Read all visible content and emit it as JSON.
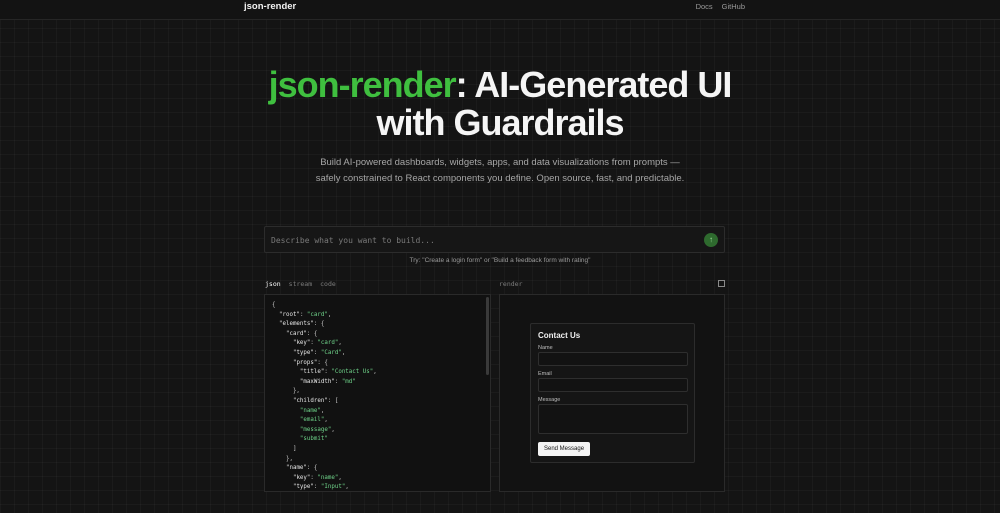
{
  "header": {
    "brand": "json-render",
    "nav": [
      "Docs",
      "GitHub"
    ]
  },
  "hero": {
    "title_accent": "json-render",
    "title_rest_line1": ": AI-Generated UI",
    "title_line2": "with Guardrails",
    "subtitle": "Build AI-powered dashboards, widgets, apps, and data visualizations from prompts — safely constrained to React components you define. Open source, fast, and predictable."
  },
  "prompt": {
    "placeholder": "Describe what you want to build...",
    "value": "",
    "send_icon": "arrow-up-icon",
    "try_text": "Try: \"Create a login form\" or \"Build a feedback form with rating\""
  },
  "tabs": {
    "items": [
      "json",
      "stream",
      "code"
    ],
    "active": "json",
    "render_label": "render"
  },
  "code_lines": [
    "{",
    "  \"root\": \"card\",",
    "  \"elements\": {",
    "    \"card\": {",
    "      \"key\": \"card\",",
    "      \"type\": \"Card\",",
    "      \"props\": {",
    "        \"title\": \"Contact Us\",",
    "        \"maxWidth\": \"md\"",
    "      },",
    "      \"children\": [",
    "        \"name\",",
    "        \"email\",",
    "        \"message\",",
    "        \"submit\"",
    "      ]",
    "    },",
    "    \"name\": {",
    "      \"key\": \"name\",",
    "      \"type\": \"Input\",",
    "      \"props\": {"
  ],
  "preview": {
    "card_title": "Contact Us",
    "fields": [
      {
        "label": "Name"
      },
      {
        "label": "Email"
      },
      {
        "label": "Message"
      }
    ],
    "submit_label": "Send Message"
  },
  "colors": {
    "accent": "#3fbf3f",
    "background": "#141414"
  }
}
